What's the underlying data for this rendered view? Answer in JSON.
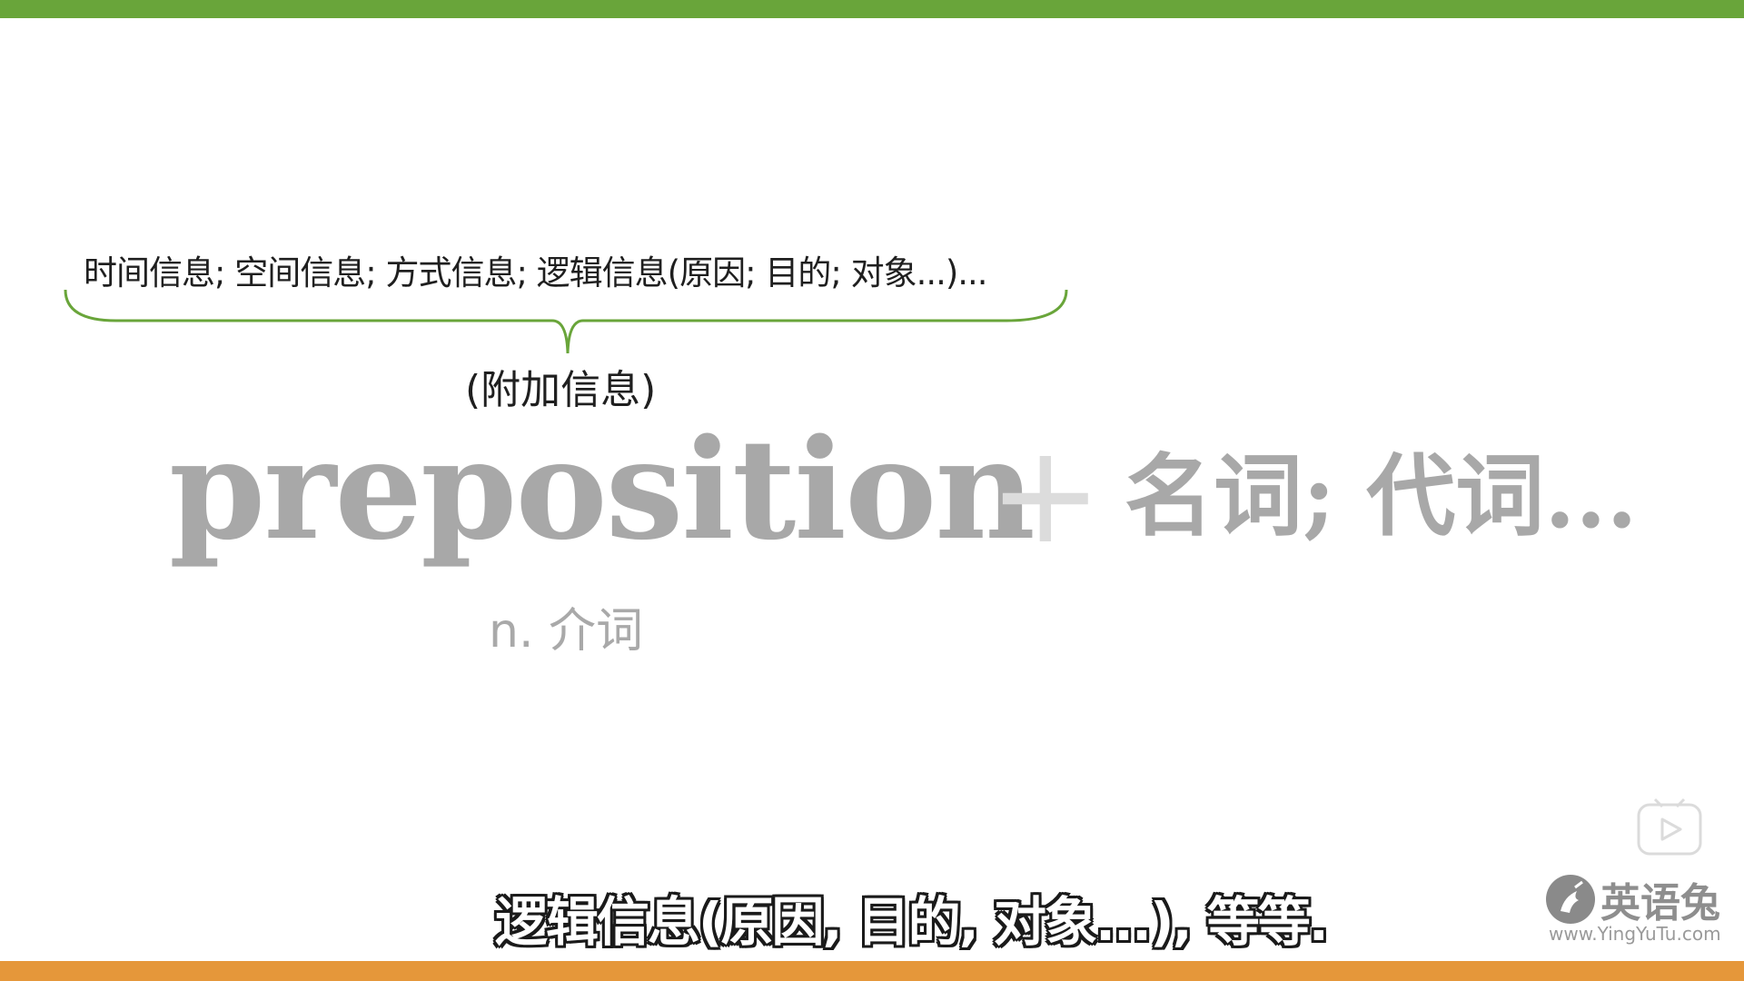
{
  "slide": {
    "info_line": "时间信息; 空间信息; 方式信息; 逻辑信息(原因; 目的; 对象...)...",
    "extra_label": "(附加信息)",
    "word": "preposition",
    "plus": "+",
    "noun_text": "名词; 代词...",
    "pos_label": "n. 介词"
  },
  "subtitle": "逻辑信息(原因, 目的, 对象...), 等等.",
  "watermark": {
    "title": "英语兔",
    "url": "www.YingYuTu.com"
  },
  "colors": {
    "top_bar": "#69a53a",
    "bottom_bar": "#e5973a",
    "brace": "#69a53a",
    "word_gray": "#a8a8a8"
  },
  "icons": {
    "play": "play-icon",
    "logo": "rabbit-logo-icon"
  }
}
